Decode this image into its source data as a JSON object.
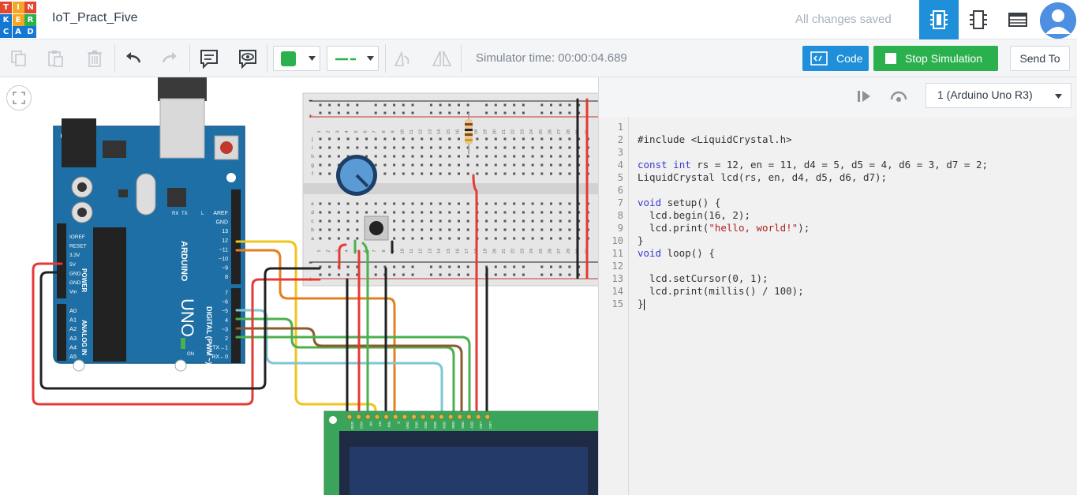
{
  "app": {
    "logo_letters": [
      "T",
      "I",
      "N",
      "K",
      "E",
      "R",
      "C",
      "A",
      "D"
    ],
    "logo_colors": [
      "#e2472f",
      "#f5a623",
      "#e2472f",
      "#1477d1",
      "#f5a623",
      "#2bb04e",
      "#1477d1",
      "#1477d1",
      "#1477d1"
    ],
    "project_title": "IoT_Pract_Five",
    "save_status": "All changes saved"
  },
  "toolbar": {
    "simulator_time": "Simulator time: 00:00:04.689",
    "code_label": "Code",
    "stop_label": "Stop Simulation",
    "sendto_label": "Send To",
    "fill_color": "#2bb04e",
    "wire_color": "#2bb04e"
  },
  "code_panel": {
    "board_select": "1 (Arduino Uno R3)",
    "lines": [
      "",
      "#include <LiquidCrystal.h>",
      "",
      "const int rs = 12, en = 11, d4 = 5, d5 = 4, d6 = 3, d7 = 2;",
      "LiquidCrystal lcd(rs, en, d4, d5, d6, d7);",
      "",
      "void setup() {",
      "  lcd.begin(16, 2);",
      "  lcd.print(\"hello, world!\");",
      "}",
      "void loop() {",
      "",
      "  lcd.setCursor(0, 1);",
      "  lcd.print(millis() / 100);",
      "}"
    ]
  },
  "circuit": {
    "arduino": {
      "brand": "ARDUINO",
      "model": "UNO",
      "digital_label": "DIGITAL (PWM ~)",
      "power_label": "POWER",
      "analog_label": "ANALOG IN",
      "on_label": "ON",
      "tx_label": "TX",
      "rx_label": "RX",
      "l_label": "L",
      "power_pins": [
        "IOREF",
        "RESET",
        "3.3V",
        "5V",
        "GND",
        "GND",
        "Vin"
      ],
      "analog_pins": [
        "A0",
        "A1",
        "A2",
        "A3",
        "A4",
        "A5"
      ],
      "digital_pins": [
        "AREF",
        "GND",
        "13",
        "12",
        "~11",
        "~10",
        "~9",
        "8",
        "7",
        "~6",
        "~5",
        "4",
        "~3",
        "2",
        "TX→1",
        "RX←0"
      ]
    },
    "lcd_pins": [
      "GND",
      "VCC",
      "V0",
      "RS",
      "RW",
      "E",
      "DB0",
      "DB1",
      "DB2",
      "DB3",
      "DB4",
      "DB5",
      "DB6",
      "DB7",
      "LED",
      "LED"
    ],
    "breadboard_columns": [
      "1",
      "2",
      "3",
      "4",
      "5",
      "6",
      "7",
      "8",
      "9",
      "10",
      "11",
      "12",
      "13",
      "14",
      "15",
      "16",
      "17",
      "18",
      "19",
      "20",
      "21",
      "22",
      "23",
      "24",
      "25",
      "26",
      "27",
      "28",
      "29",
      "30"
    ],
    "breadboard_rows_top": [
      "j",
      "i",
      "h",
      "g",
      "f"
    ],
    "breadboard_rows_bottom": [
      "e",
      "d",
      "c",
      "b",
      "a"
    ],
    "rail_plus": "+",
    "rail_minus": "−"
  }
}
